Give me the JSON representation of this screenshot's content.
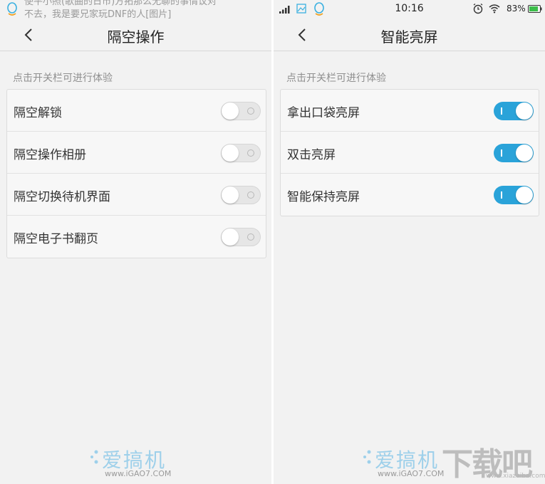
{
  "left": {
    "notification_lines": [
      "使平小照(歌曲的日市)方拓那么无聊的事情议对",
      "不去，我是要兄家玩DNF的人[图片]"
    ],
    "title": "隔空操作",
    "hint": "点击开关栏可进行体验",
    "rows": [
      {
        "label": "隔空解锁",
        "state": "off"
      },
      {
        "label": "隔空操作相册",
        "state": "off"
      },
      {
        "label": "隔空切换待机界面",
        "state": "off"
      },
      {
        "label": "隔空电子书翻页",
        "state": "off"
      }
    ],
    "watermark": {
      "main": "爱搞机",
      "sub": "www.iGAO7.COM"
    }
  },
  "right": {
    "status": {
      "time": "10:16",
      "battery": "83%"
    },
    "title": "智能亮屏",
    "hint": "点击开关栏可进行体验",
    "rows": [
      {
        "label": "拿出口袋亮屏",
        "state": "on"
      },
      {
        "label": "双击亮屏",
        "state": "on"
      },
      {
        "label": "智能保持亮屏",
        "state": "on"
      }
    ],
    "watermark": {
      "main": "爱搞机",
      "sub": "www.iGAO7.COM"
    },
    "site_logo": {
      "main": "下载吧",
      "sub": "www.xiazaiba.com"
    }
  },
  "colors": {
    "toggle_on": "#2aa3d9",
    "toggle_off": "#e6e6e6",
    "background": "#f2f2f2"
  }
}
